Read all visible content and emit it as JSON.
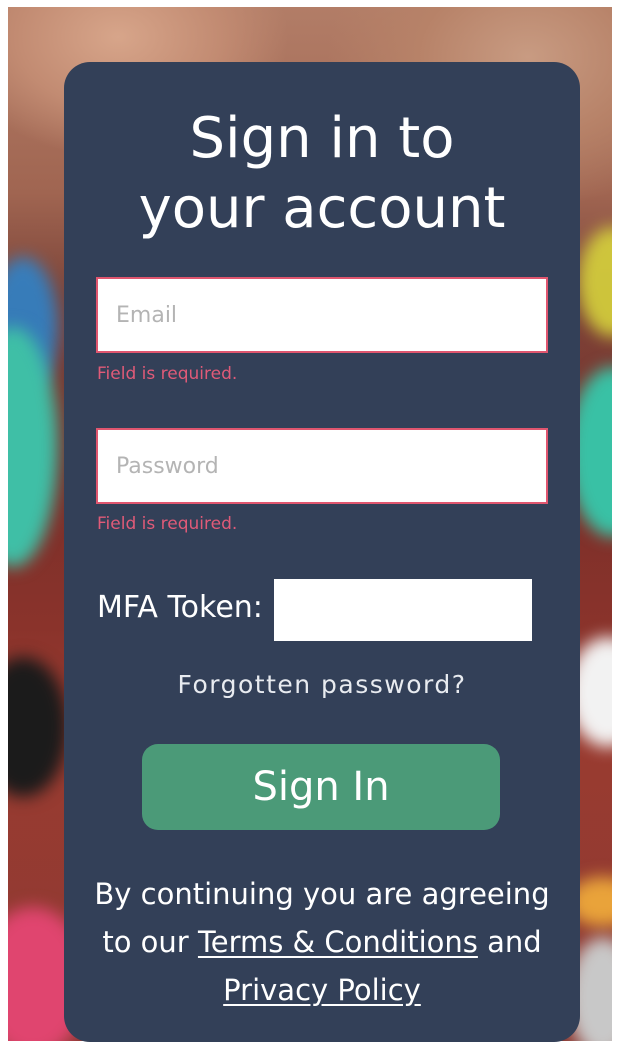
{
  "page": {
    "title_line1": "Sign in to",
    "title_line2": "your account"
  },
  "form": {
    "email_placeholder": "Email",
    "email_value": "",
    "email_error": "Field is required.",
    "password_placeholder": "Password",
    "password_value": "",
    "password_error": "Field is required.",
    "mfa_label": "MFA Token:",
    "mfa_value": "",
    "forgot_link": "Forgotten password?",
    "submit_label": "Sign In"
  },
  "legal": {
    "prefix": "By continuing you are agreeing to our ",
    "terms_link": "Terms & Conditions",
    "middle": " and ",
    "privacy_link": "Privacy Policy"
  },
  "colors": {
    "card_background": "#334058",
    "error": "#e05a78",
    "button": "#4b9a78",
    "text": "#ffffff"
  }
}
